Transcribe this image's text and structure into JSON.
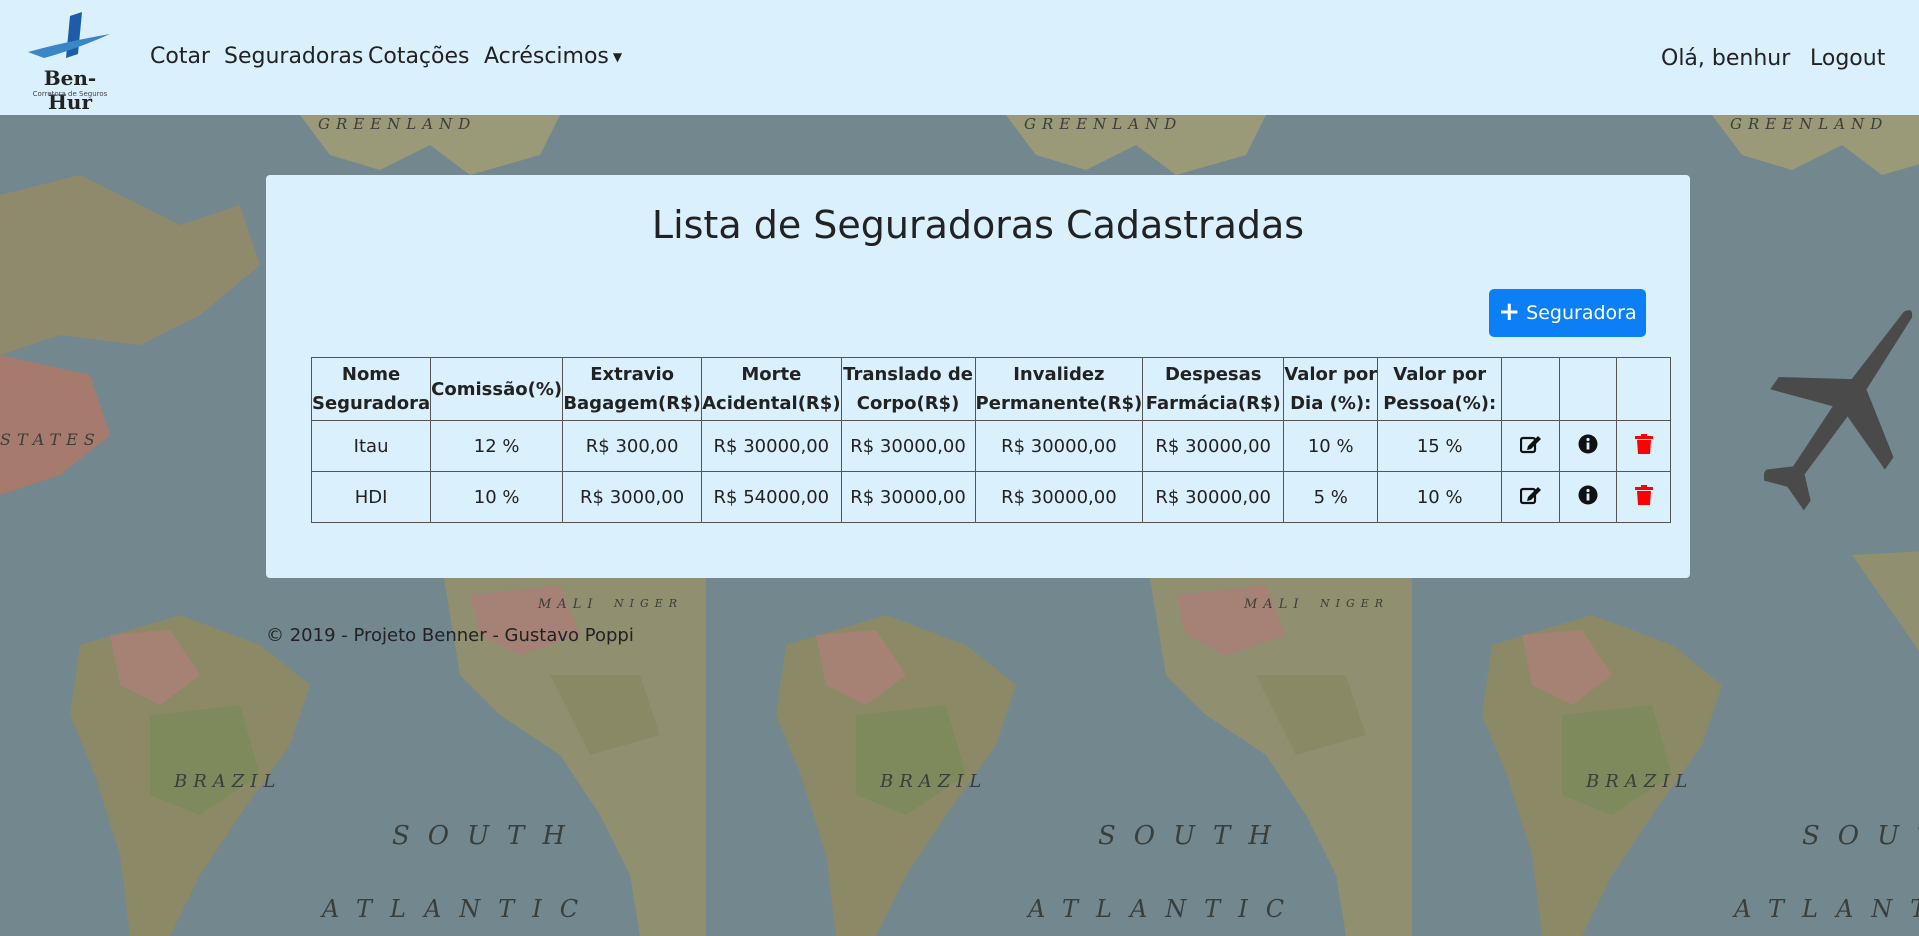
{
  "brand": {
    "name": "Ben-Hur",
    "tagline": "Corretora de Seguros"
  },
  "nav": {
    "cotar": "Cotar",
    "seguradoras": "Seguradoras",
    "cotacoes": "Cotações",
    "acrescimos": "Acréscimos",
    "greeting": "Olá, benhur",
    "logout": "Logout"
  },
  "map_labels": {
    "greenland": "GREENLAND",
    "brazil": "BRAZIL",
    "south": "SOUTH",
    "atlantic": "ATLANTIC",
    "states": "STATES",
    "mali": "MALI",
    "niger": "NIGER"
  },
  "page": {
    "title": "Lista de Seguradoras Cadastradas",
    "add_button": "Seguradora"
  },
  "table": {
    "headers": [
      [
        "Nome",
        "Seguradora"
      ],
      [
        "Comissão(%)",
        ""
      ],
      [
        "Extravio",
        "Bagagem(R$)"
      ],
      [
        "Morte",
        "Acidental(R$)"
      ],
      [
        "Translado de",
        "Corpo(R$)"
      ],
      [
        "Invalidez",
        "Permanente(R$)"
      ],
      [
        "Despesas",
        "Farmácia(R$)"
      ],
      [
        "Valor por",
        "Dia (%):"
      ],
      [
        "Valor por",
        "Pessoa(%):"
      ]
    ],
    "rows": [
      [
        "Itau",
        "12 %",
        "R$ 300,00",
        "R$ 30000,00",
        "R$ 30000,00",
        "R$ 30000,00",
        "R$ 30000,00",
        "10 %",
        "15 %"
      ],
      [
        "HDI",
        "10 %",
        "R$ 3000,00",
        "R$ 54000,00",
        "R$ 30000,00",
        "R$ 30000,00",
        "R$ 30000,00",
        "5 %",
        "10 %"
      ]
    ],
    "action_icons": [
      "edit-icon",
      "info-icon",
      "trash-icon"
    ]
  },
  "footer": "© 2019 - Projeto Benner - Gustavo Poppi",
  "colors": {
    "navbar": "#dbf0fd",
    "primary": "#0d7ff6",
    "danger": "#ff0000"
  }
}
